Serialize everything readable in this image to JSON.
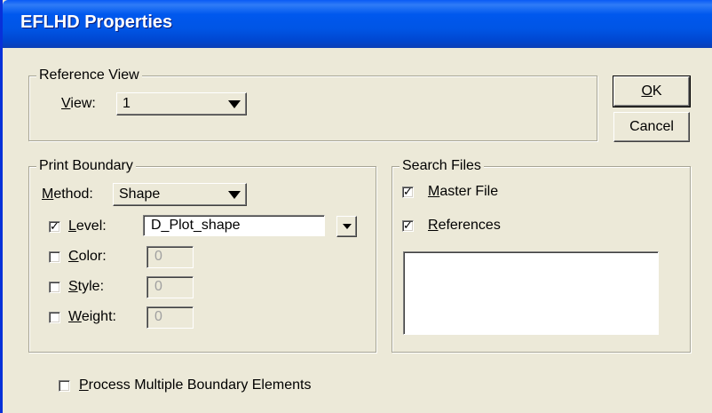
{
  "window": {
    "title": "EFLHD Properties"
  },
  "reference_view": {
    "group_label": "Reference View",
    "view_label": "View:",
    "view_value": "1"
  },
  "buttons": {
    "ok": "OK",
    "cancel": "Cancel"
  },
  "print_boundary": {
    "group_label": "Print Boundary",
    "method_label": "Method:",
    "method_value": "Shape",
    "level": {
      "label": "Level:",
      "checked": true,
      "value": "D_Plot_shape"
    },
    "color": {
      "label": "Color:",
      "checked": false,
      "value": "0"
    },
    "style": {
      "label": "Style:",
      "checked": false,
      "value": "0"
    },
    "weight": {
      "label": "Weight:",
      "checked": false,
      "value": "0"
    }
  },
  "search_files": {
    "group_label": "Search Files",
    "master_file": {
      "label": "Master File",
      "checked": true
    },
    "references": {
      "label": "References",
      "checked": true
    }
  },
  "process_multiple": {
    "label": "Process Multiple Boundary Elements",
    "checked": false
  }
}
